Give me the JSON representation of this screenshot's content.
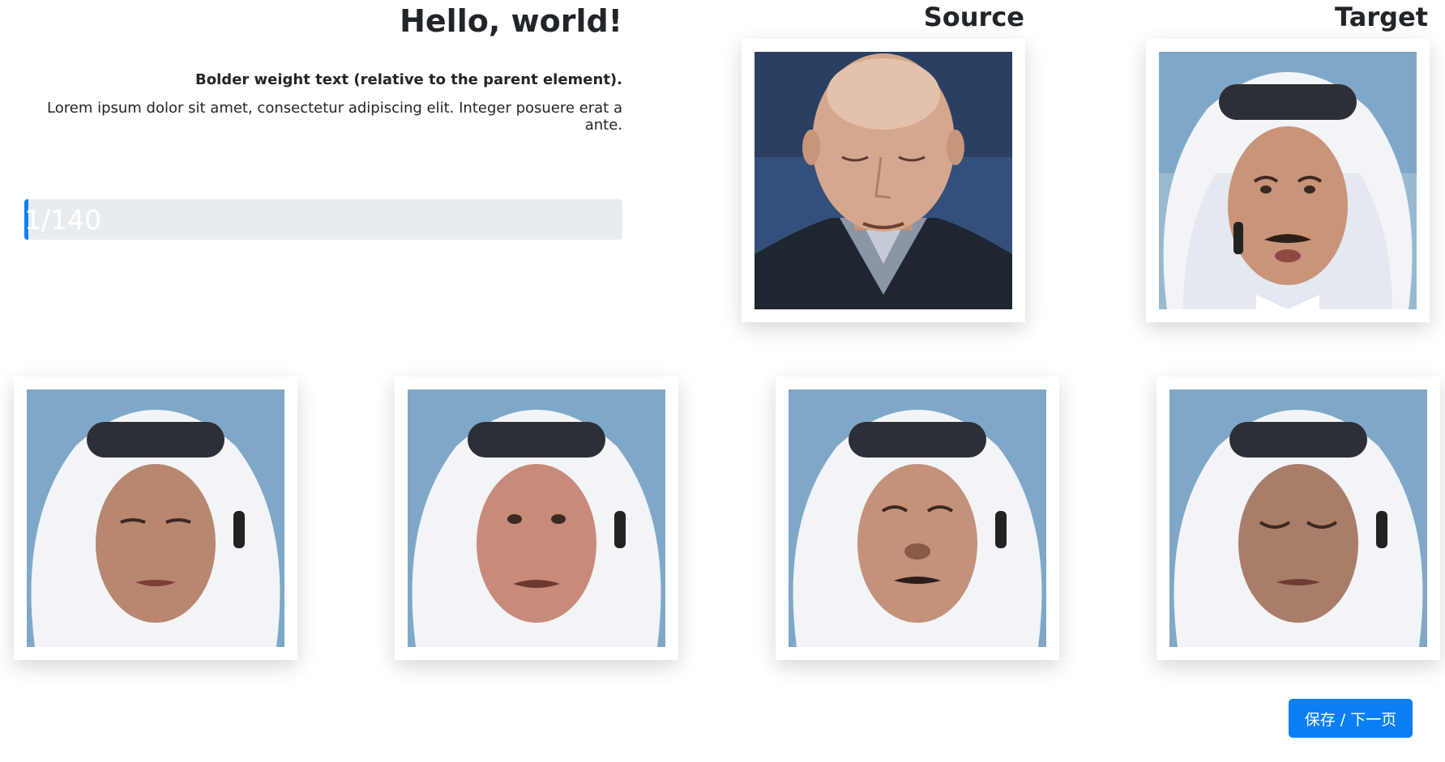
{
  "intro": {
    "title": "Hello, world!",
    "bold_text": "Bolder weight text (relative to the parent element).",
    "lead_text": "Lorem ipsum dolor sit amet, consectetur adipiscing elit. Integer posuere erat a ante."
  },
  "progress": {
    "current": 1,
    "total": 140,
    "label": "1/140",
    "fill_fraction": 0.007
  },
  "labels": {
    "source": "Source",
    "target": "Target"
  },
  "images": {
    "source": "Source face: bald man with eyes closed, dark sweater and collared shirt",
    "target": "Target face: man wearing white headscarf and black agal, mustache, earpiece",
    "results": [
      "Face-swap result 1",
      "Face-swap result 2",
      "Face-swap result 3",
      "Face-swap result 4"
    ]
  },
  "actions": {
    "save_next": "保存 / 下一页"
  },
  "colors": {
    "primary": "#0a7ff5",
    "progress_track": "#e9ecef",
    "text": "#212529"
  }
}
